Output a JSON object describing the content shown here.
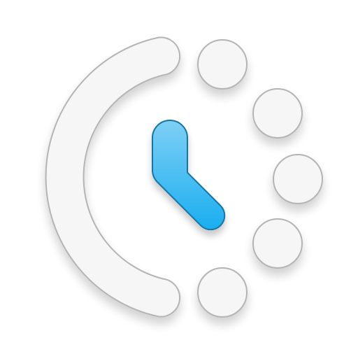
{
  "icon": {
    "name": "schedule-clock-icon",
    "dot_count": 5,
    "colors": {
      "background": "#ffffff",
      "shape_fill": "#f6f6f7",
      "shape_stroke": "#b4b4b4",
      "hands_gradient_top": "#7ecff5",
      "hands_gradient_bottom": "#1aaef0",
      "hands_stroke": "#1676a3"
    }
  }
}
